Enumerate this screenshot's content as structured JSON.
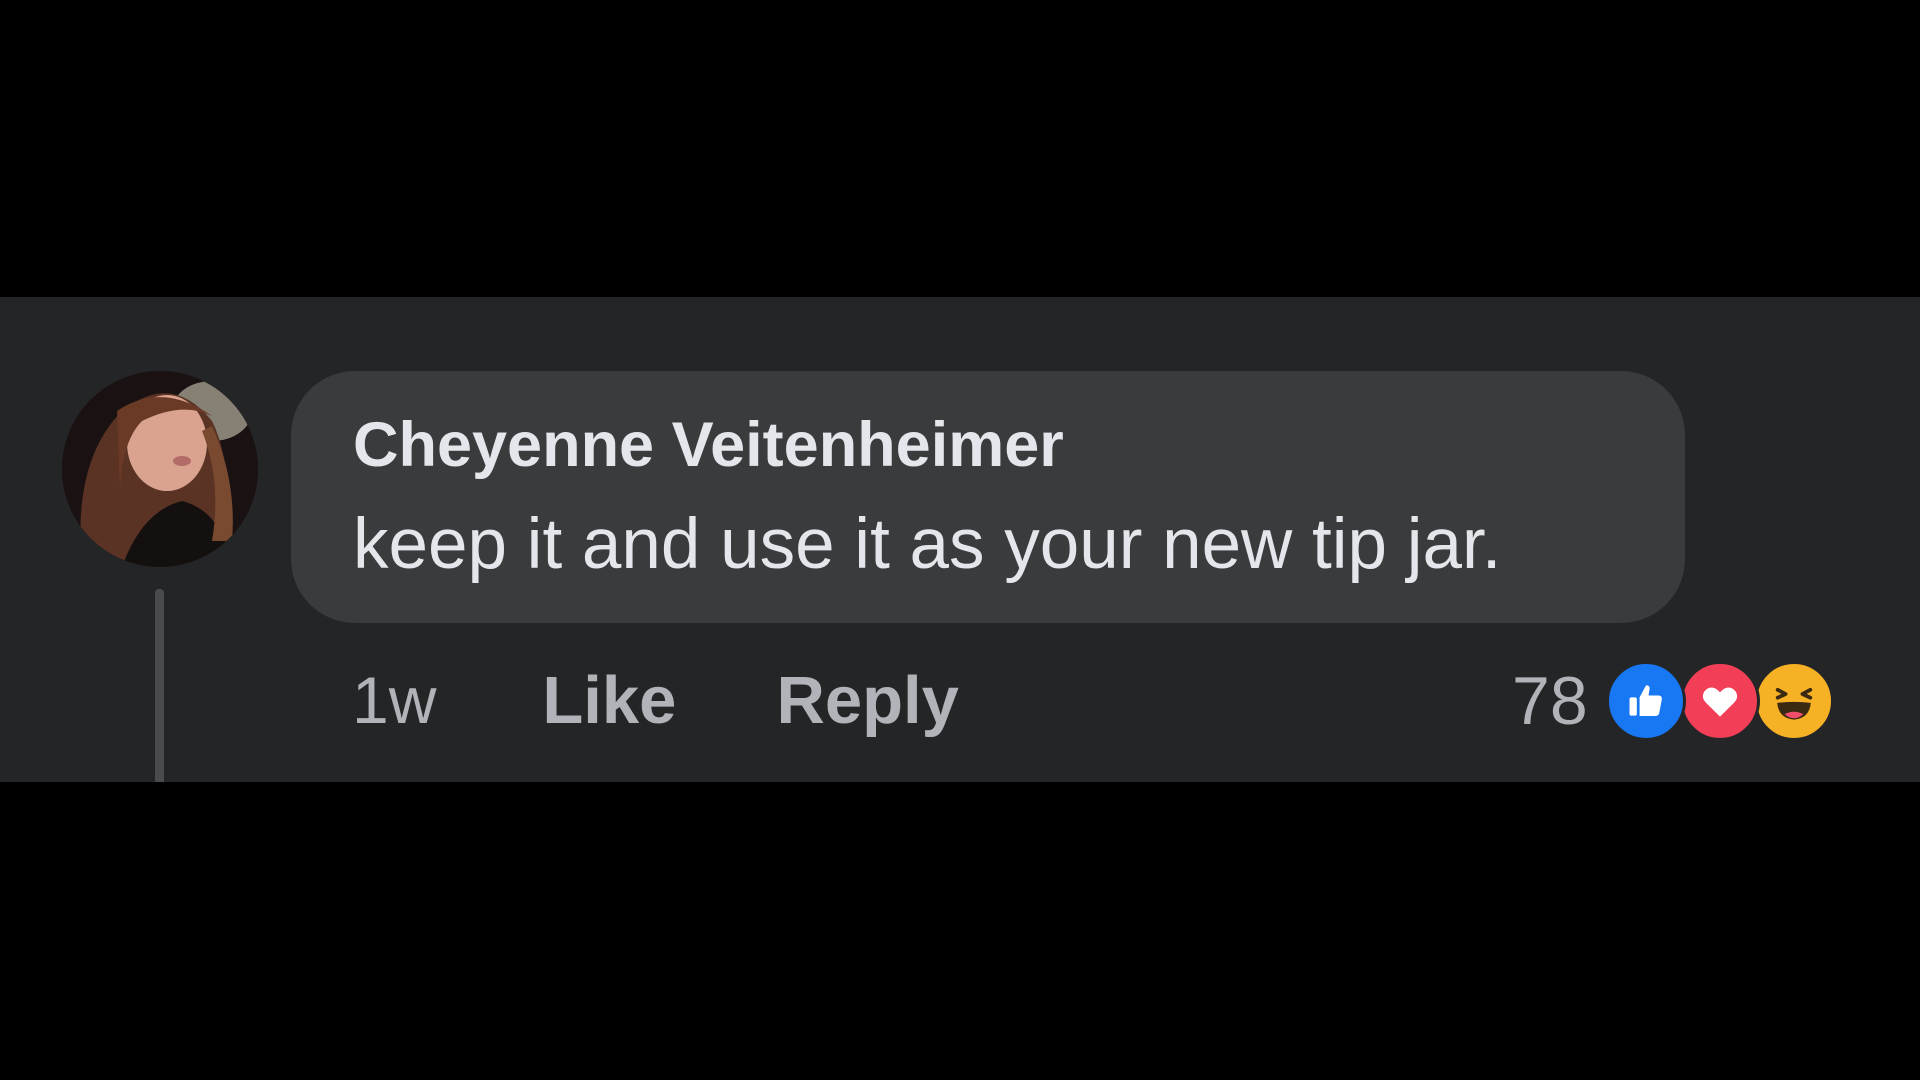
{
  "comment": {
    "author": "Cheyenne Veitenheimer",
    "text": "keep it and use it as your new tip jar.",
    "timestamp": "1w",
    "like_label": "Like",
    "reply_label": "Reply"
  },
  "reactions": {
    "count": "78",
    "types": [
      "like-icon",
      "love-icon",
      "haha-icon"
    ],
    "colors": {
      "like": "#1877f2",
      "love": "#f33e58",
      "haha": "#f7b125"
    }
  },
  "theme": {
    "page_background": "#000000",
    "panel_background": "#242526",
    "bubble_background": "#3a3b3c",
    "primary_text": "#e4e6eb",
    "secondary_text": "#b0b3b8"
  }
}
